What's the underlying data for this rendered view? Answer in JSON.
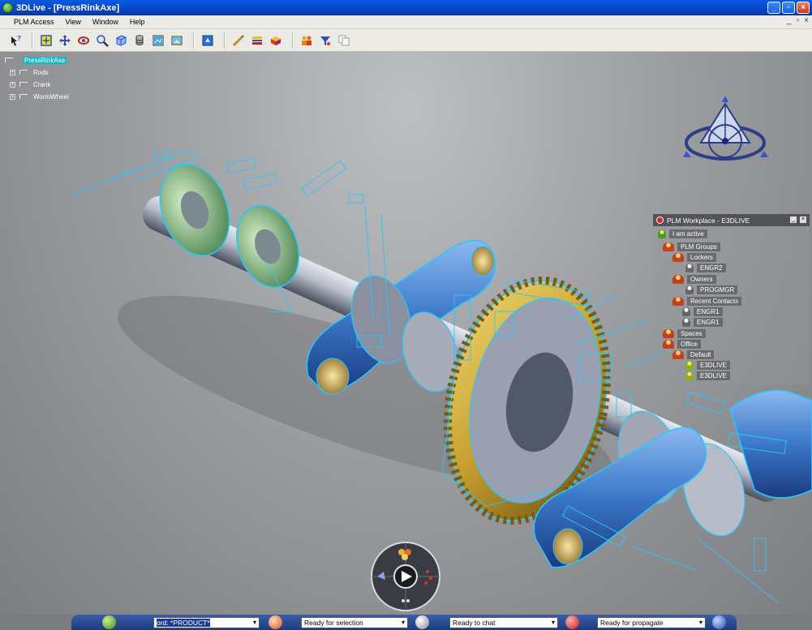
{
  "window": {
    "title": "3DLive - [PressRinkAxe]",
    "controls": [
      "_",
      "▫",
      "×"
    ]
  },
  "menu": {
    "items": [
      "PLM Access",
      "View",
      "Window",
      "Help"
    ],
    "mdi_controls": [
      "_",
      "▫",
      "×"
    ]
  },
  "toolbar": {
    "buttons": [
      "help-icon",
      "fit-all-icon",
      "pan-icon",
      "rotate-icon",
      "zoom-icon",
      "normal-view-icon",
      "view-mode-icon",
      "render-icon",
      "capture-icon",
      "export-icon",
      "measure-icon",
      "section-icon",
      "explode-icon",
      "group-icon",
      "filter-icon",
      "copy-icon"
    ]
  },
  "spec_tree": {
    "root": "PressRinkAxe",
    "children": [
      "Rods",
      "Crank",
      "WormWheel"
    ]
  },
  "plm_workplace": {
    "title": "PLM Workplace - E3DLIVE",
    "status": "I am active",
    "items": [
      {
        "label": "PLM Groups",
        "icon": "group"
      },
      {
        "label": "Lockers",
        "icon": "group"
      },
      {
        "label": "ENGR2",
        "icon": "grey"
      },
      {
        "label": "Owners",
        "icon": "group"
      },
      {
        "label": "PROGMGR",
        "icon": "grey"
      },
      {
        "label": "Recent Contacts",
        "icon": "group"
      },
      {
        "label": "ENGR1",
        "icon": "grey"
      },
      {
        "label": "ENGR1",
        "icon": "grey"
      },
      {
        "label": "Spaces",
        "icon": "group"
      },
      {
        "label": "Office",
        "icon": "group"
      },
      {
        "label": "Default",
        "icon": "group"
      },
      {
        "label": "E3DLIVE",
        "icon": "yel"
      },
      {
        "label": "E3DLIVE",
        "icon": "yel"
      }
    ]
  },
  "statusbar": {
    "search_field": "ord: *PRODUCT*",
    "selection_status": "Ready for selection",
    "chat_status": "Ready to chat",
    "propagate_status": "Ready for propagate"
  },
  "colors": {
    "titlebar": "#0846c8",
    "tree_highlight": "#18b8c8",
    "annotation_cyan": "#27c8ff",
    "part_blue": "#3a78c8",
    "gear_gold": "#c8a030"
  }
}
